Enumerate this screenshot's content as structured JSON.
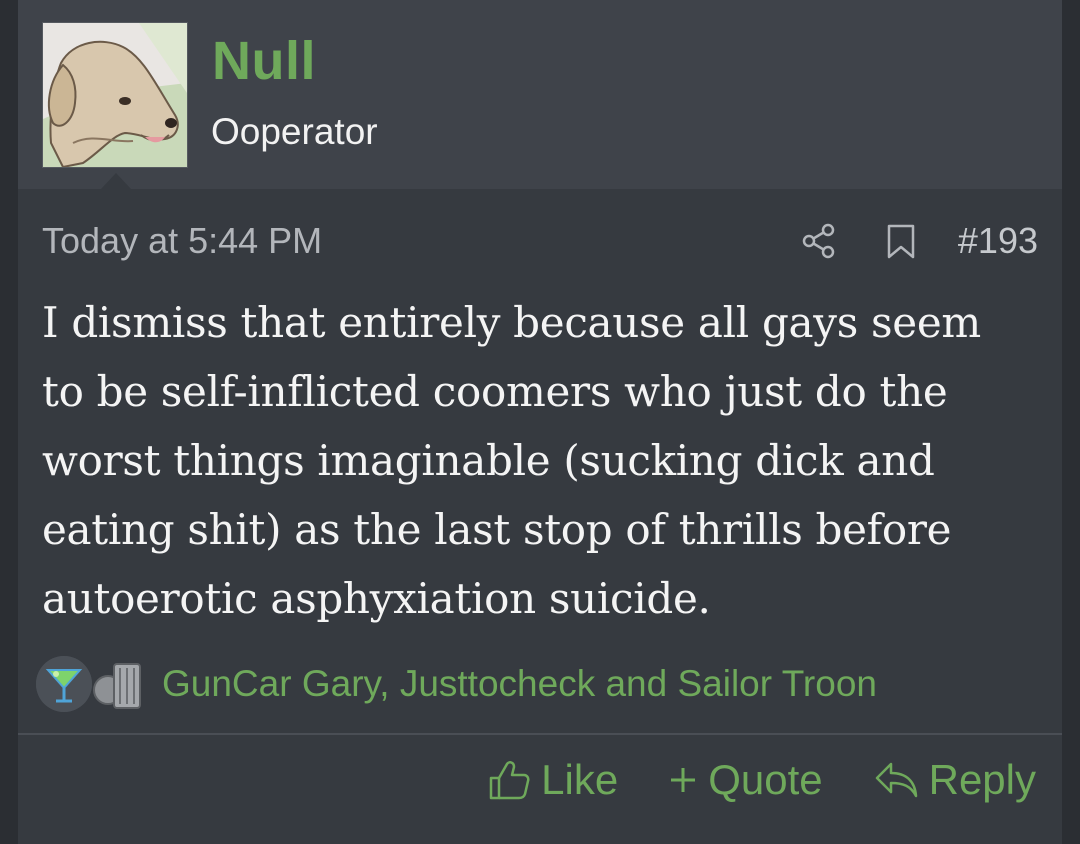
{
  "post": {
    "username": "Null",
    "user_title": "Ooperator",
    "date": "Today at 5:44 PM",
    "number": "#193",
    "body_lines": [
      "I dismiss that entirely because all gays seem",
      "to be self-inflicted coomers who just do the",
      "worst things imaginable (sucking dick and",
      "eating shit) as the last stop of thrills before",
      "autoerotic asphyxiation suicide."
    ],
    "reactions": {
      "icons": [
        "cocktail-icon",
        "trash-can-icon"
      ],
      "users_text": "GunCar Gary, Justtocheck and Sailor Troon"
    }
  },
  "actions": {
    "like_label": "Like",
    "quote_label": "Quote",
    "reply_label": "Reply"
  },
  "colors": {
    "accent_green": "#6fa95b",
    "header_bg": "#3f434a",
    "body_bg": "#363a40",
    "text_primary": "#f4f4f4",
    "text_muted": "#b3b6bb"
  }
}
